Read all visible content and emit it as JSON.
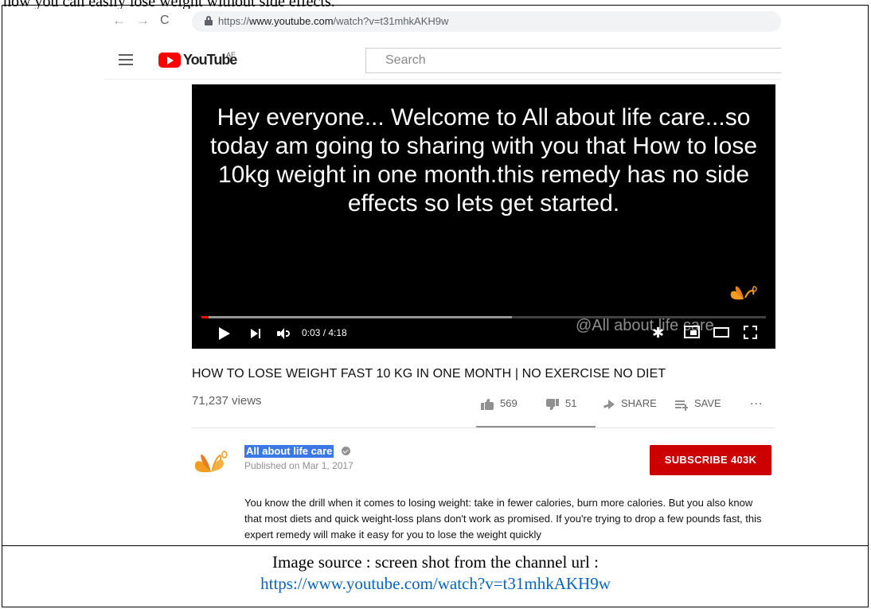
{
  "doc": {
    "top_text": "how you can easily lose weight without side effects.",
    "source_label": "Image source : screen shot from the channel url :",
    "source_url": "https://www.youtube.com/watch?v=t31mhkAKH9w"
  },
  "browser": {
    "back_glyph": "←",
    "forward_glyph": "→",
    "reload_glyph": "C",
    "url_scheme": "https://",
    "url_host": "www.youtube.com",
    "url_path": "/watch?v=t31mhkAKH9w"
  },
  "youtube": {
    "logo_text": "YouTube",
    "region": "AE",
    "search_placeholder": "Search"
  },
  "player": {
    "caption": "Hey everyone...  Welcome to All about life care...so today am going to sharing with you that How to lose 10kg weight in one month.this remedy has no side effects so lets get started.",
    "watermark": "@All about life care",
    "time": "0:03 / 4:18",
    "gear_glyph": "✱",
    "played_fraction": 0.012,
    "buffered_fraction": 0.55
  },
  "video": {
    "title": "HOW TO LOSE WEIGHT FAST 10 KG IN ONE MONTH | NO EXERCISE NO DIET",
    "views": "71,237 views",
    "likes": "569",
    "dislikes": "51",
    "share_label": "SHARE",
    "save_label": "SAVE",
    "more_glyph": "..."
  },
  "channel": {
    "name": "All about life care",
    "published": "Published on Mar 1, 2017",
    "subscribe_label": "SUBSCRIBE",
    "subscriber_count": "403K",
    "description": "You know the drill when it comes to losing weight: take in fewer calories, burn more calories. But you also know that most diets and quick weight-loss plans don't work as promised. If you're trying to drop a few pounds fast, this expert remedy will make it easy for you to lose the weight quickly"
  },
  "colors": {
    "youtube_red": "#ff0000",
    "subscribe_red": "#cc0000",
    "selection_blue": "#3b78e7",
    "link_blue": "#0563c1",
    "brand_orange": "#f39c1f"
  }
}
